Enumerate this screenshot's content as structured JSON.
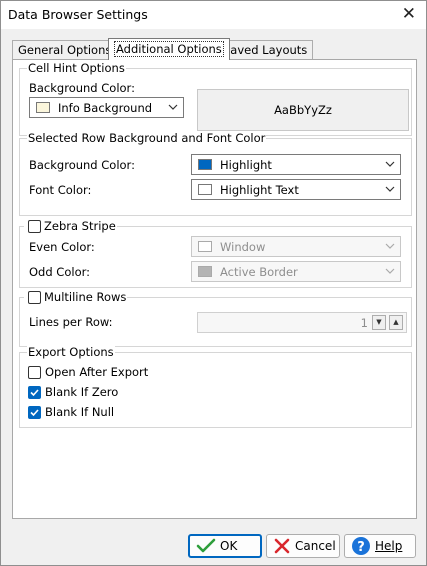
{
  "window": {
    "title": "Data Browser Settings",
    "close_glyph": "✕"
  },
  "tabs": [
    {
      "label": "General Options",
      "active": false
    },
    {
      "label": "Additional Options",
      "active": true
    },
    {
      "label": "Saved Layouts",
      "active": false
    }
  ],
  "cell_hint": {
    "title": "Cell Hint Options",
    "bg_label": "Background Color:",
    "bg_value": "Info Background",
    "bg_swatch": "#fbf6dc",
    "preview_text": "AaBbYyZz"
  },
  "selected_row": {
    "title": "Selected Row Background and Font Color",
    "bg_label": "Background Color:",
    "bg_value": "Highlight",
    "bg_swatch": "#0067c0",
    "font_label": "Font Color:",
    "font_value": "Highlight Text",
    "font_swatch": "#ffffff"
  },
  "zebra": {
    "title": "Zebra Stripe",
    "checked": false,
    "even_label": "Even Color:",
    "even_value": "Window",
    "even_swatch": "#ffffff",
    "odd_label": "Odd Color:",
    "odd_value": "Active Border",
    "odd_swatch": "#b4b4b4"
  },
  "multiline": {
    "title": "Multiline Rows",
    "checked": false,
    "lines_label": "Lines per Row:",
    "lines_value": "1"
  },
  "export": {
    "title": "Export Options",
    "open_after": {
      "label": "Open After Export",
      "checked": false
    },
    "blank_zero": {
      "label": "Blank If Zero",
      "checked": true
    },
    "blank_null": {
      "label": "Blank If Null",
      "checked": true
    }
  },
  "buttons": {
    "ok": "OK",
    "cancel": "Cancel",
    "help": "Help"
  },
  "colors": {
    "accent": "#0067c0",
    "ok_icon": "#2e9e3b",
    "cancel_icon": "#d9262c",
    "help_icon": "#1a73d9"
  }
}
